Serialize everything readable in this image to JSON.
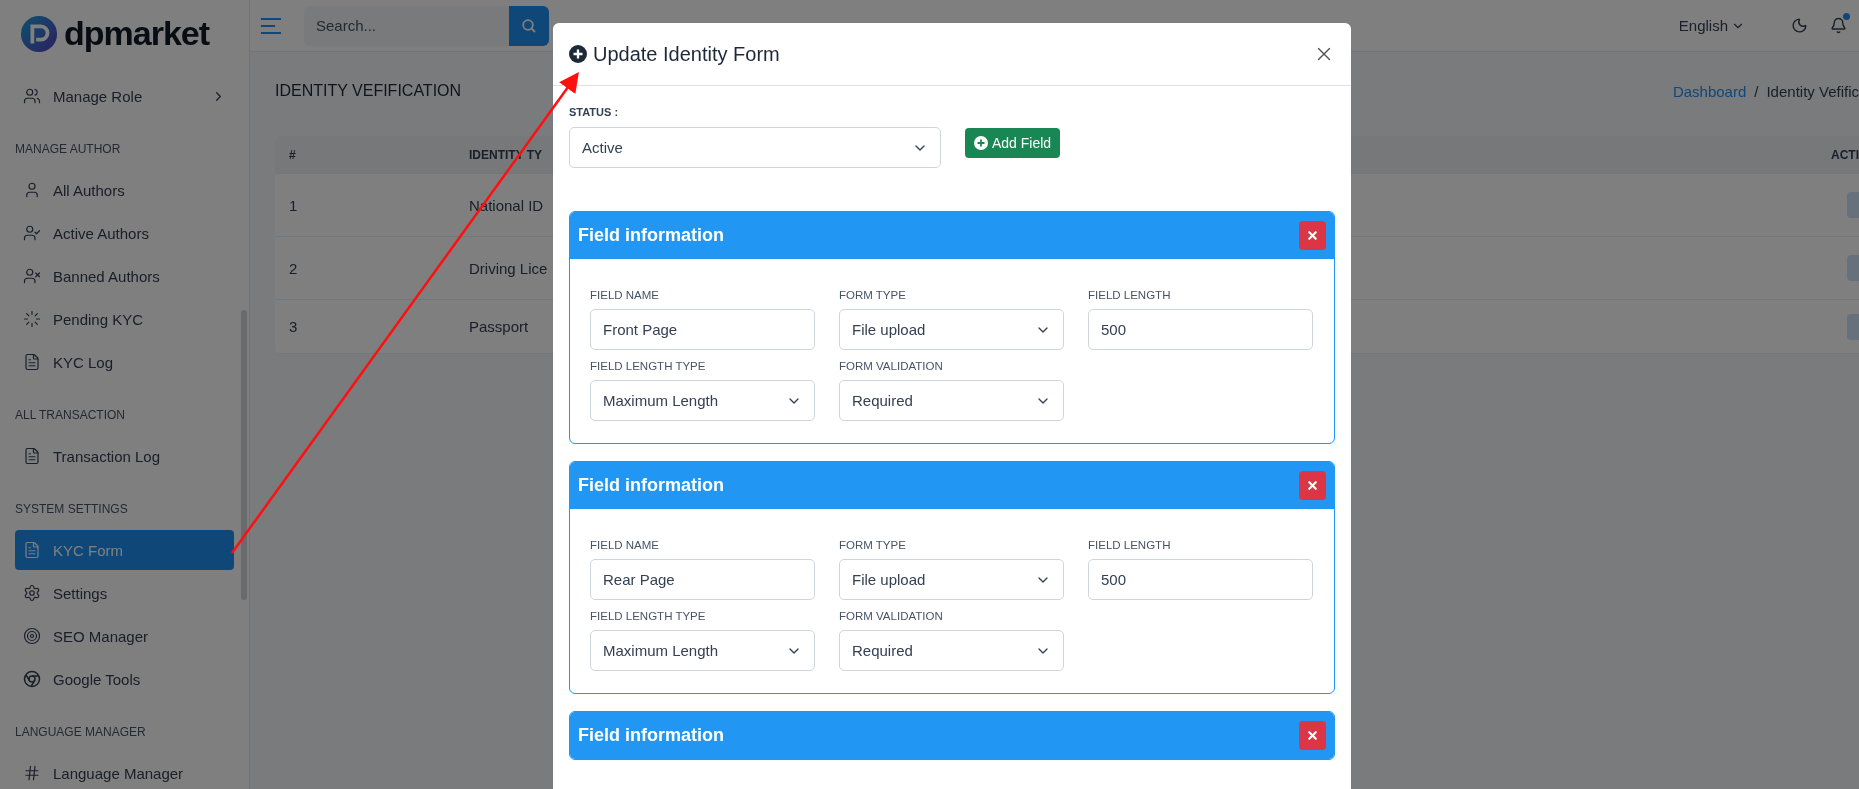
{
  "brand": {
    "name": "dpmarket"
  },
  "sidebar": {
    "groups": [
      {
        "items": [
          {
            "label": "Manage Role",
            "selected": false,
            "submenu": true
          }
        ]
      },
      {
        "heading": "MANAGE AUTHOR",
        "items": [
          {
            "label": "All Authors",
            "selected": false,
            "submenu": false
          },
          {
            "label": "Active Authors",
            "selected": false,
            "submenu": false
          },
          {
            "label": "Banned Authors",
            "selected": false,
            "submenu": false
          },
          {
            "label": "Pending KYC",
            "selected": false,
            "submenu": false
          },
          {
            "label": "KYC Log",
            "selected": false,
            "submenu": false
          }
        ]
      },
      {
        "heading": "ALL TRANSACTION",
        "items": [
          {
            "label": "Transaction Log",
            "selected": false,
            "submenu": false
          }
        ]
      },
      {
        "heading": "SYSTEM SETTINGS",
        "items": [
          {
            "label": "KYC Form",
            "selected": true,
            "submenu": false
          },
          {
            "label": "Settings",
            "selected": false,
            "submenu": false
          },
          {
            "label": "SEO Manager",
            "selected": false,
            "submenu": false
          },
          {
            "label": "Google Tools",
            "selected": false,
            "submenu": false
          }
        ]
      },
      {
        "heading": "LANGUAGE MANAGER",
        "items": [
          {
            "label": "Language Manager",
            "selected": false,
            "submenu": false
          }
        ]
      }
    ]
  },
  "topbar": {
    "search": {
      "placeholder": "Search..."
    },
    "language": "English",
    "notification": true
  },
  "page": {
    "title": "IDENTITY VEFIFICATION",
    "breadcrumb": [
      "Dashboard",
      "Identity Vefific"
    ],
    "breadcrumb_separator": "/",
    "table": {
      "columns": [
        "#",
        "IDENTITY TY",
        "ACTI"
      ],
      "rows": [
        {
          "cells": [
            "1",
            "National ID"
          ]
        },
        {
          "cells": [
            "2",
            "Driving Lice"
          ]
        },
        {
          "cells": [
            "3",
            "Passport"
          ]
        }
      ]
    }
  },
  "modal": {
    "title": "Update Identity Form",
    "status": {
      "label": "STATUS :",
      "value": "Active"
    },
    "add_button": "Add Field",
    "cards": [
      {
        "title": "Field information",
        "fields": [
          {
            "label": "FIELD NAME",
            "value": "Front Page",
            "kind": "text"
          },
          {
            "label": "FORM TYPE",
            "value": "File upload",
            "kind": "select"
          },
          {
            "label": "FIELD LENGTH",
            "value": "500",
            "kind": "text"
          },
          {
            "label": "FIELD LENGTH TYPE",
            "value": "Maximum Length",
            "kind": "select"
          },
          {
            "label": "FORM VALIDATION",
            "value": "Required",
            "kind": "select"
          }
        ]
      },
      {
        "title": "Field information",
        "fields": [
          {
            "label": "FIELD NAME",
            "value": "Rear Page",
            "kind": "text"
          },
          {
            "label": "FORM TYPE",
            "value": "File upload",
            "kind": "select"
          },
          {
            "label": "FIELD LENGTH",
            "value": "500",
            "kind": "text"
          },
          {
            "label": "FIELD LENGTH TYPE",
            "value": "Maximum Length",
            "kind": "select"
          },
          {
            "label": "FORM VALIDATION",
            "value": "Required",
            "kind": "select"
          }
        ]
      },
      {
        "title": "Field information"
      }
    ]
  }
}
